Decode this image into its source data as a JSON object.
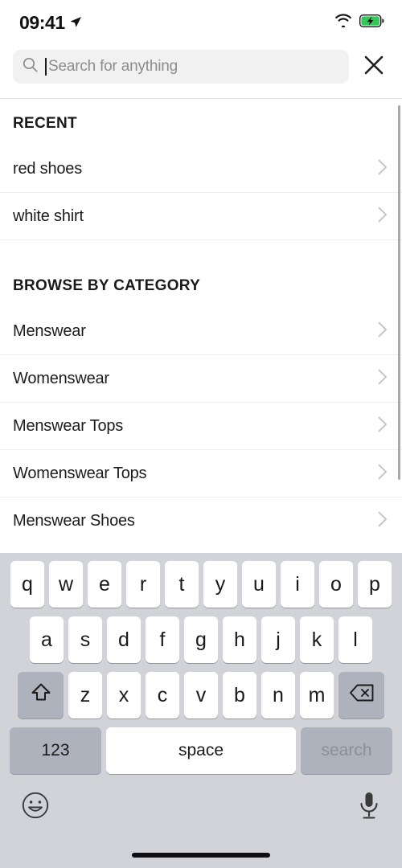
{
  "status_bar": {
    "time": "09:41",
    "location_icon": "location-arrow-icon",
    "wifi_icon": "wifi-icon",
    "battery_icon": "battery-charging-icon",
    "battery_color": "#34c759"
  },
  "search": {
    "icon": "search-icon",
    "placeholder": "Search for anything",
    "value": "",
    "caret_visible": true,
    "close_label": "close-icon",
    "field_background": "#f1f1f1"
  },
  "sections": [
    {
      "title": "RECENT",
      "items": [
        {
          "label": "red shoes",
          "chevron": "chevron-right-icon"
        },
        {
          "label": "white shirt",
          "chevron": "chevron-right-icon"
        }
      ]
    },
    {
      "title": "BROWSE BY CATEGORY",
      "items": [
        {
          "label": "Menswear",
          "chevron": "chevron-right-icon"
        },
        {
          "label": "Womenswear",
          "chevron": "chevron-right-icon"
        },
        {
          "label": "Menswear Tops",
          "chevron": "chevron-right-icon"
        },
        {
          "label": "Womenswear Tops",
          "chevron": "chevron-right-icon"
        },
        {
          "label": "Menswear Shoes",
          "chevron": "chevron-right-icon"
        }
      ]
    }
  ],
  "keyboard": {
    "row1": [
      "q",
      "w",
      "e",
      "r",
      "t",
      "y",
      "u",
      "i",
      "o",
      "p"
    ],
    "row2": [
      "a",
      "s",
      "d",
      "f",
      "g",
      "h",
      "j",
      "k",
      "l"
    ],
    "row3_letters": [
      "z",
      "x",
      "c",
      "v",
      "b",
      "n",
      "m"
    ],
    "shift_label": "shift-icon",
    "delete_label": "delete-icon",
    "numbers_label": "123",
    "space_label": "space",
    "action_label": "search",
    "action_enabled": false,
    "emoji_label": "emoji-icon",
    "dictation_label": "microphone-icon",
    "background": "#d1d3d9",
    "key_background": "#ffffff",
    "function_key_background": "#aeb2bd"
  }
}
